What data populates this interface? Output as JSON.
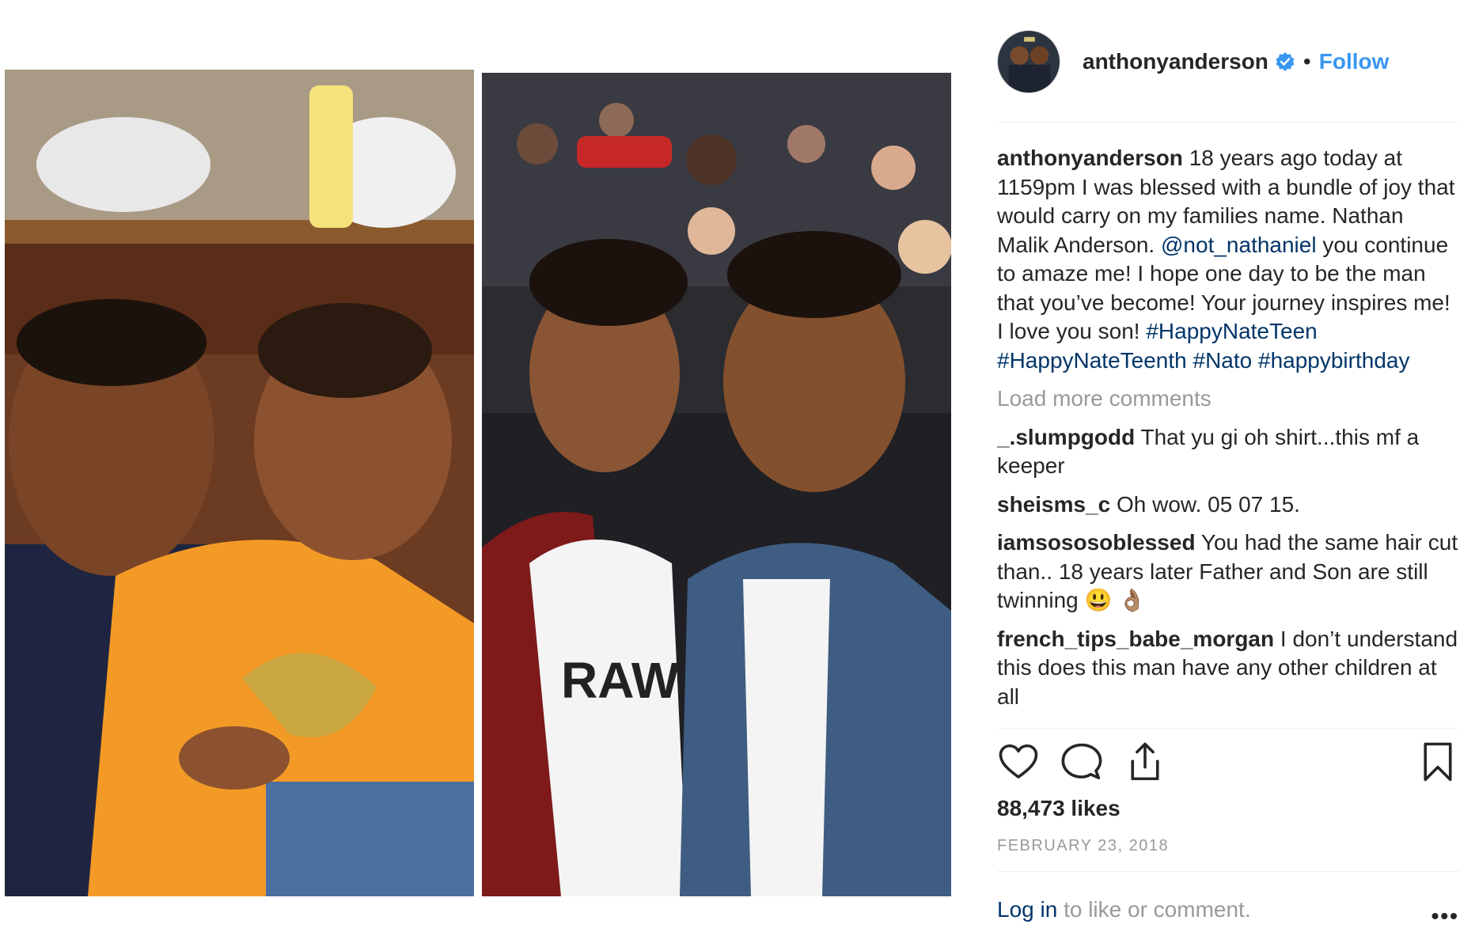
{
  "post": {
    "username": "anthonyanderson",
    "dot": "•",
    "follow_label": "Follow",
    "caption": {
      "user": "anthonyanderson",
      "text_1": " 18 years ago today at 1159pm I was blessed with a bundle of joy that would carry on my families name. Nathan Malik Anderson. ",
      "mention": "@not_nathaniel",
      "text_2": " you continue to amaze me! I hope one day to be the man that you’ve become! Your journey inspires me! I love you son! ",
      "hashtags": "#HappyNateTeen #HappyNateTeenth #Nato #happybirthday"
    },
    "load_more": "Load more comments",
    "comments": [
      {
        "user": "_.slumpgodd",
        "text": " That yu gi oh shirt...this mf a keeper"
      },
      {
        "user": "sheisms_c",
        "text": " Oh wow. 05 07 15."
      },
      {
        "user": "iamsososoblessed",
        "text": " You had the same hair cut than.. 18 years later Father and Son are still twinning 😃 👌🏽"
      },
      {
        "user": "french_tips_babe_morgan",
        "text": " I don’t understand this does this man have any other children at all"
      }
    ],
    "likes": "88,473 likes",
    "date": "FEBRUARY 23, 2018",
    "footer": {
      "login": "Log in",
      "rest": " to like or comment."
    },
    "more_label": "•••"
  },
  "icons": {
    "like": "heart-icon",
    "comment": "comment-icon",
    "share": "share-icon",
    "save": "bookmark-icon",
    "verified": "verified-badge-icon"
  },
  "colors": {
    "link": "#003569",
    "follow": "#3897f0",
    "muted": "#999999",
    "text": "#262626"
  }
}
